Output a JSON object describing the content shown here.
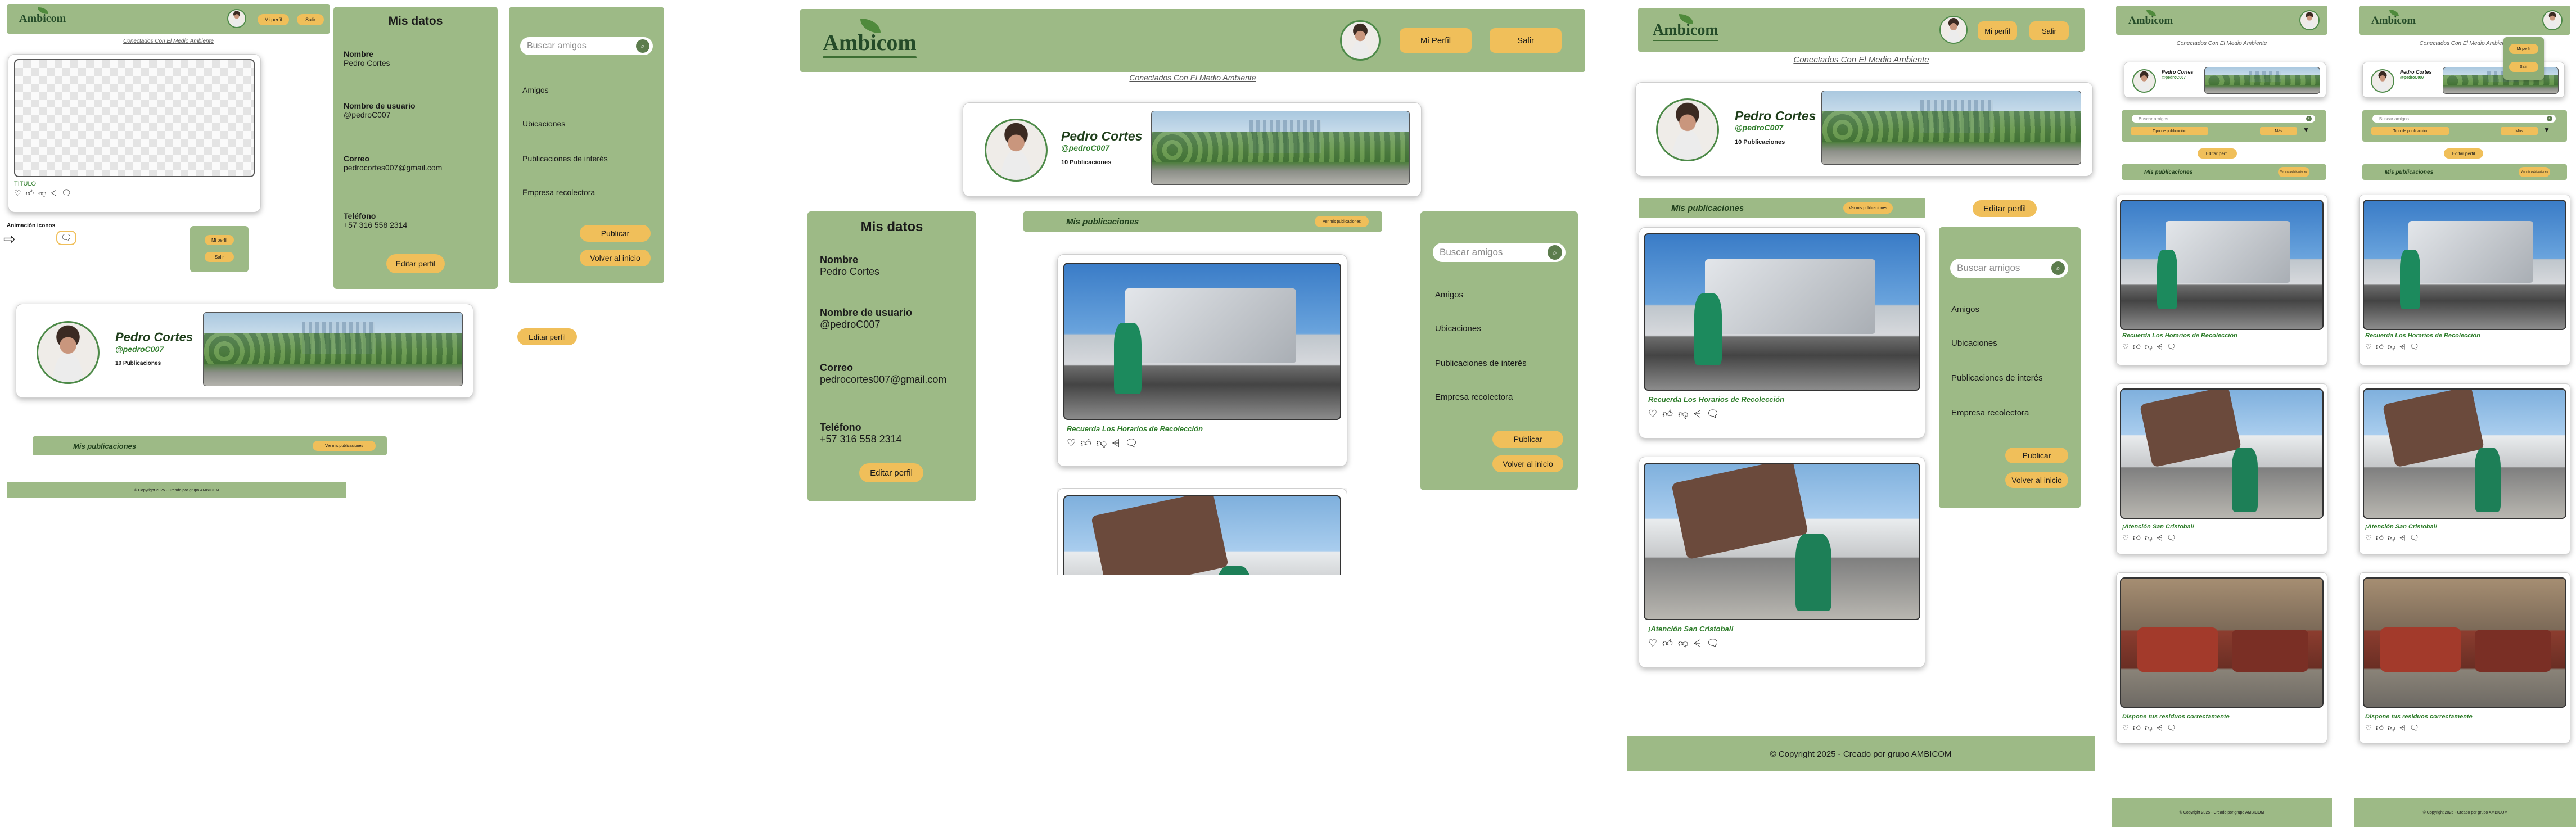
{
  "brand": {
    "logo": "Ambicom",
    "tagline": "Conectados Con El Medio Ambiente"
  },
  "header": {
    "profile_btn": "Mi Perfil",
    "profile_btn_small": "Mi perfil",
    "logout_btn": "Salir"
  },
  "profile": {
    "name": "Pedro Cortes",
    "handle": "@pedroC007",
    "posts": "10 Publicaciones"
  },
  "data_panel": {
    "title": "Mis datos",
    "name_label": "Nombre",
    "name_value": "Pedro Cortes",
    "user_label": "Nombre de usuario",
    "user_value": "@pedroC007",
    "email_label": "Correo",
    "email_value": "pedrocortes007@gmail.com",
    "phone_label": "Teléfono",
    "phone_value": "+57 316 558 2314",
    "edit_btn": "Editar perfil"
  },
  "sidebar": {
    "search_placeholder": "Buscar amigos",
    "items": [
      "Amigos",
      "Ubicaciones",
      "Publicaciones de interés",
      "Empresa recolectora"
    ],
    "publish_btn": "Publicar",
    "home_btn": "Volver al inicio"
  },
  "posts_bar": {
    "label": "Mis publicaciones",
    "badge": "Ver mis publicaciones"
  },
  "posts": [
    {
      "title": "Recuerda Los Horarios de Recolección"
    },
    {
      "title": "¡Atención San Cristobal!"
    },
    {
      "title": "Dispone tus residuos correctamente"
    }
  ],
  "template_card": {
    "title": "TITULO"
  },
  "anim_label": "Animación iconos",
  "filters": {
    "select1": "Tipo de publicación",
    "select2": "Más"
  },
  "footer": {
    "text": "© Copyright 2025 - Creado por grupo AMBICOM",
    "text_small": "© Copyright 2025 - Creado por grupo AMBICOM"
  },
  "icons": [
    "heart-icon",
    "like-icon",
    "dislike-icon",
    "share-icon",
    "comment-icon"
  ],
  "colors": {
    "panel": "#9dba86",
    "button": "#f0bf5a",
    "title_green": "#2e7d2a"
  }
}
